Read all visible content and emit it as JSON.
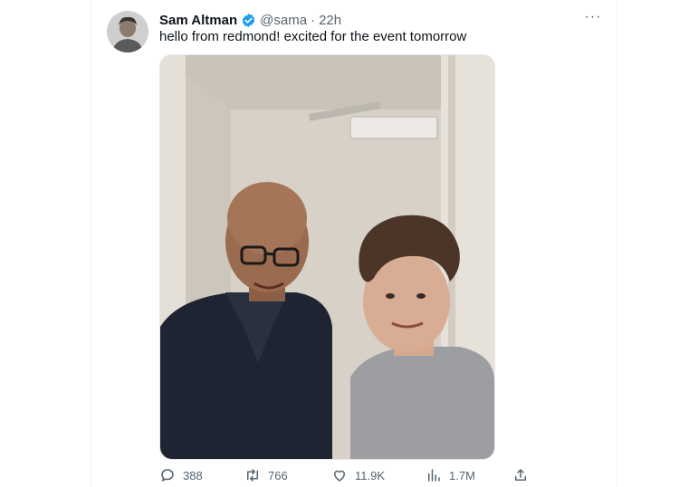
{
  "tweet": {
    "author_name": "Sam Altman",
    "handle": "@sama",
    "separator": "·",
    "time": "22h",
    "text": "hello from redmond! excited for the event tomorrow",
    "more_label": "···"
  },
  "icons": {
    "avatar": "profile-photo",
    "verified": "verified-badge-icon",
    "more": "more-options-icon",
    "reply": "reply-icon",
    "retweet": "retweet-icon",
    "like": "heart-icon",
    "views": "views-chart-icon",
    "share": "share-icon"
  },
  "metrics": {
    "replies": "388",
    "retweets": "766",
    "likes": "11.9K",
    "views": "1.7M"
  },
  "colors": {
    "verified_blue": "#1d9bf0",
    "secondary_text": "#536471"
  }
}
